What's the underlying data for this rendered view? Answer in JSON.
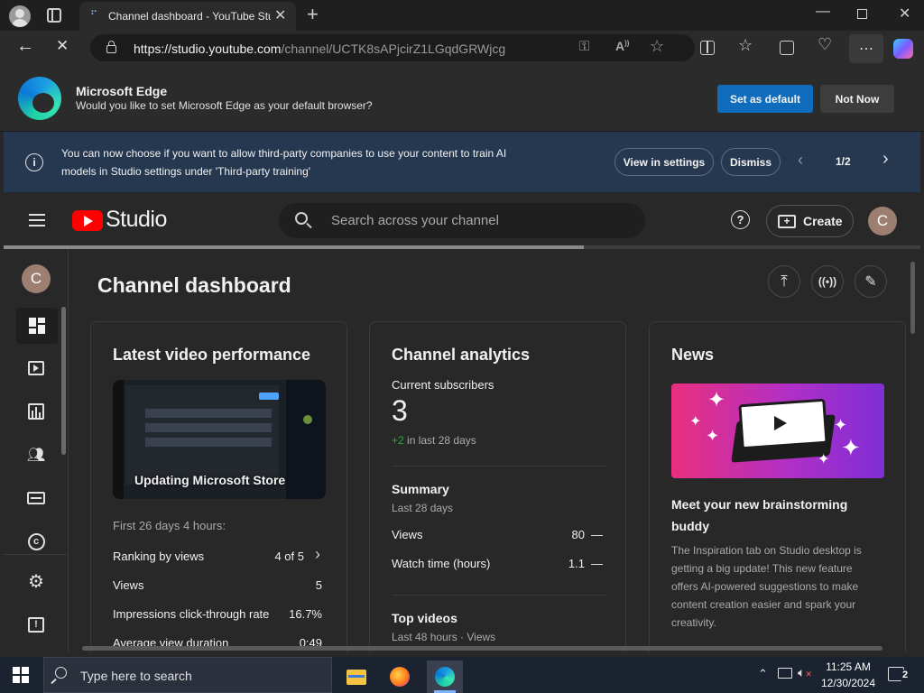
{
  "browser": {
    "tab_title": "Channel dashboard - YouTube Stu",
    "url_host": "https://studio.youtube.com",
    "url_path": "/channel/UCTK8sAPjcirZ1LGqdGRWjcg"
  },
  "edge_banner": {
    "title": "Microsoft Edge",
    "message": "Would you like to set Microsoft Edge as your default browser?",
    "set_default_label": "Set as default",
    "not_now_label": "Not Now"
  },
  "notice": {
    "line1": "You can now choose if you want to allow third-party companies to use your content to train AI",
    "line2": "models in Studio settings under 'Third-party training'",
    "view_settings_label": "View in settings",
    "dismiss_label": "Dismiss",
    "pager": "1/2"
  },
  "header": {
    "logo_text": "Studio",
    "search_placeholder": "Search across your channel",
    "create_label": "Create",
    "avatar_letter": "C"
  },
  "sidebar": {
    "avatar_letter": "C"
  },
  "page": {
    "title": "Channel dashboard"
  },
  "latest_video": {
    "title": "Latest video performance",
    "thumb_caption": "Updating Microsoft Store",
    "period": "First 26 days 4 hours:",
    "rows": [
      {
        "label": "Ranking by views",
        "value": "4 of 5"
      },
      {
        "label": "Views",
        "value": "5"
      },
      {
        "label": "Impressions click-through rate",
        "value": "16.7%"
      },
      {
        "label": "Average view duration",
        "value": "0:49"
      }
    ]
  },
  "analytics": {
    "title": "Channel analytics",
    "subs_label": "Current subscribers",
    "subs_value": "3",
    "subs_delta": "+2",
    "subs_delta_suffix": "in last 28 days",
    "summary_title": "Summary",
    "summary_period": "Last 28 days",
    "rows": [
      {
        "label": "Views",
        "value": "80",
        "trend": "—"
      },
      {
        "label": "Watch time (hours)",
        "value": "1.1",
        "trend": "—"
      }
    ],
    "top_videos_title": "Top videos",
    "top_videos_period": "Last 48 hours · Views"
  },
  "news": {
    "title": "News",
    "headline_l1": "Meet your new brainstorming",
    "headline_l2": "buddy",
    "body": [
      "The Inspiration tab on Studio desktop is",
      "getting a big update! This new feature",
      "offers AI-powered suggestions to make",
      "content creation easier and spark your",
      "creativity."
    ]
  },
  "taskbar": {
    "search_placeholder": "Type here to search",
    "time": "11:25 AM",
    "date": "12/30/2024",
    "notif_count": "2"
  },
  "progress": {
    "fraction": 0.633
  },
  "colors": {
    "accent_blue": "#0f6cbd",
    "yt_red": "#ff0000",
    "notice_bg": "#263850",
    "green": "#2ba640"
  }
}
